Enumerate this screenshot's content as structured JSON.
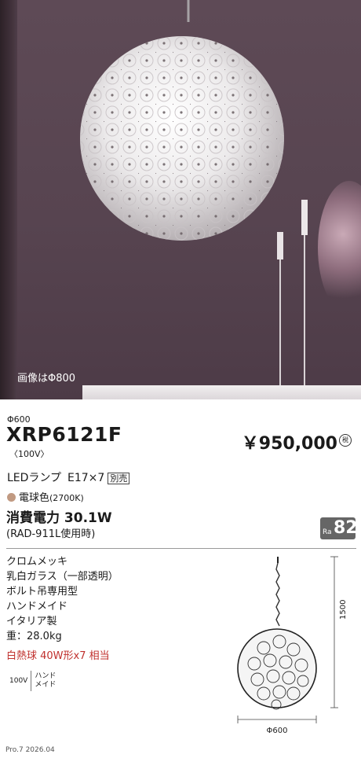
{
  "photo": {
    "caption": "画像はΦ800"
  },
  "product": {
    "size": "Φ600",
    "model": "XRP6121F",
    "voltage": "〈100V〉",
    "price": "￥950,000",
    "price_mark": "税"
  },
  "lamp": {
    "type": "LEDランプ",
    "socket": "E17×7",
    "badge": "別売"
  },
  "color": {
    "name": "電球色",
    "temp": "(2700K)",
    "swatch": "#c19a82"
  },
  "power": {
    "label": "消費電力 30.1W",
    "note": "(RAD-911L使用時)"
  },
  "ra": {
    "label": "Ra",
    "value": "82"
  },
  "specs": [
    "クロムメッキ",
    "乳白ガラス（一部透明）",
    "ボルト吊専用型",
    "ハンドメイド",
    "イタリア製",
    "重：28.0kg"
  ],
  "equiv": "白熱球 40W形x7 相当",
  "icons": {
    "voltage": "100V",
    "handmade_1": "ハンド",
    "handmade_2": "メイド"
  },
  "drawing": {
    "width": "Φ600",
    "height": "1500"
  },
  "footer": "Pro.7 2026.04",
  "colors": {
    "red": "#c0302d",
    "ra_bg": "#666666"
  }
}
